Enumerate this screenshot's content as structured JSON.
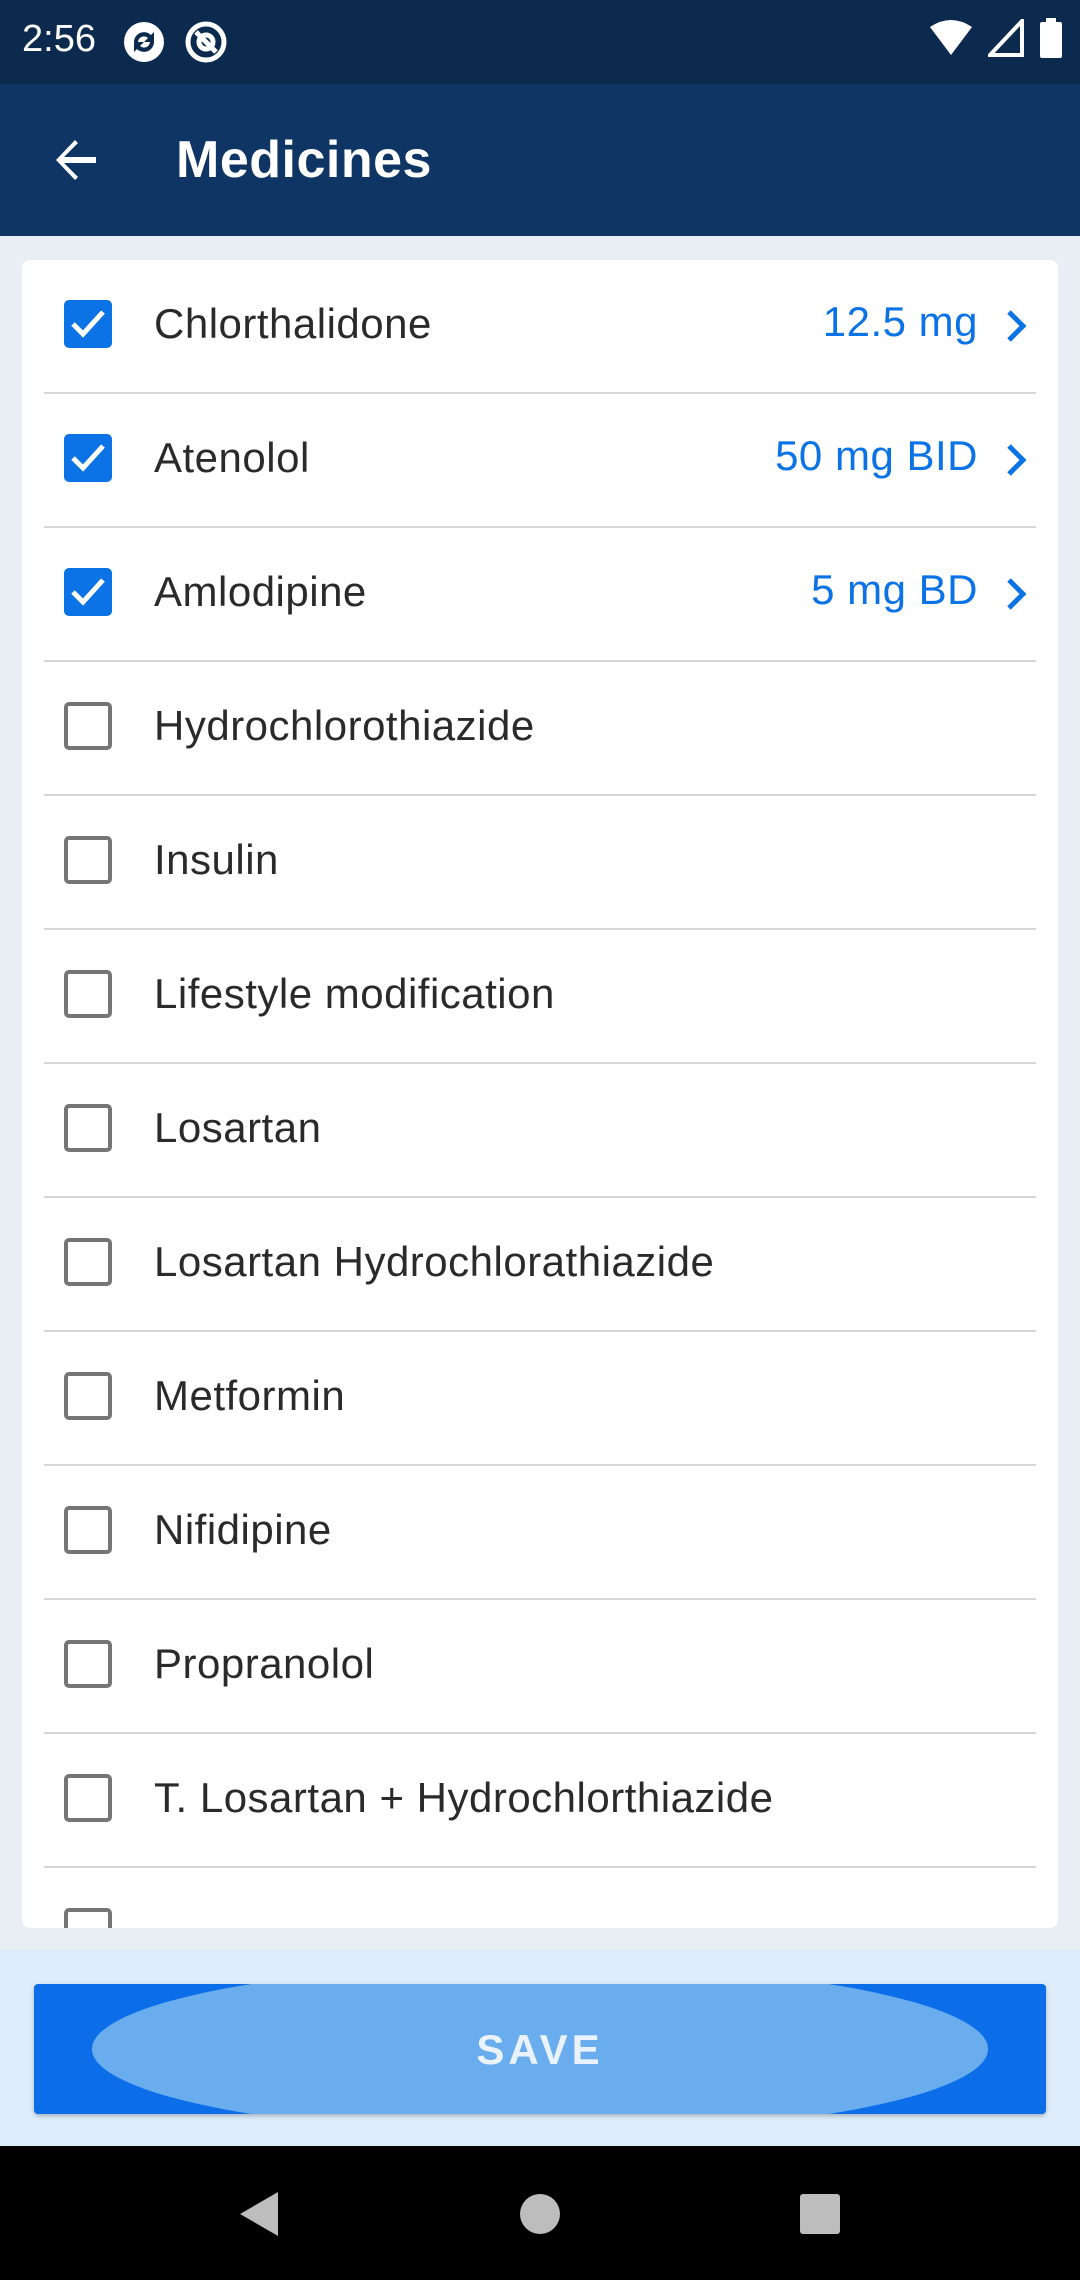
{
  "status_bar": {
    "time": "2:56"
  },
  "toolbar": {
    "title": "Medicines"
  },
  "medicines": [
    {
      "name": "Chlorthalidone",
      "dose": "12.5 mg",
      "checked": true
    },
    {
      "name": "Atenolol",
      "dose": "50 mg BID",
      "checked": true
    },
    {
      "name": "Amlodipine",
      "dose": "5 mg BD",
      "checked": true
    },
    {
      "name": "Hydrochlorothiazide",
      "dose": "",
      "checked": false
    },
    {
      "name": "Insulin",
      "dose": "",
      "checked": false
    },
    {
      "name": "Lifestyle modification",
      "dose": "",
      "checked": false
    },
    {
      "name": "Losartan",
      "dose": "",
      "checked": false
    },
    {
      "name": "Losartan Hydrochlorathiazide",
      "dose": "",
      "checked": false
    },
    {
      "name": "Metformin",
      "dose": "",
      "checked": false
    },
    {
      "name": "Nifidipine",
      "dose": "",
      "checked": false
    },
    {
      "name": "Propranolol",
      "dose": "",
      "checked": false
    },
    {
      "name": "T. Losartan + Hydrochlorthiazide",
      "dose": "",
      "checked": false
    }
  ],
  "save_button": {
    "label": "SAVE"
  },
  "colors": {
    "accent": "#0b73e6",
    "toolbar": "#0e3563",
    "status_bar": "#0b2a4e"
  }
}
